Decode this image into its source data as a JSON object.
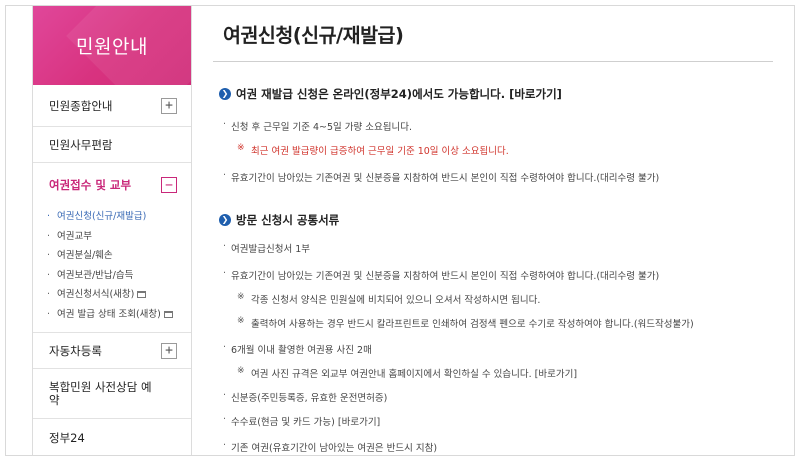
{
  "sidebar": {
    "header": "민원안내",
    "items": [
      {
        "label": "민원종합안내",
        "toggle": "+"
      },
      {
        "label": "민원사무편람",
        "toggle": ""
      },
      {
        "label": "여권접수 및 교부",
        "toggle": "−"
      },
      {
        "label": "자동차등록",
        "toggle": "+"
      },
      {
        "label": "복합민원 사전상담 예약",
        "toggle": ""
      },
      {
        "label": "정부24",
        "toggle": ""
      }
    ],
    "submenu": [
      {
        "label": "여권신청(신규/재발급)",
        "popup": false
      },
      {
        "label": "여권교부",
        "popup": false
      },
      {
        "label": "여권분실/훼손",
        "popup": false
      },
      {
        "label": "여권보관/반납/습득",
        "popup": false
      },
      {
        "label": "여권신청서식(새창)",
        "popup": true
      },
      {
        "label": "여권 발급 상태 조회(새창)",
        "popup": true
      }
    ]
  },
  "main": {
    "title": "여권신청(신규/재발급)",
    "section1": {
      "heading": "여권 재발급 신청은 온라인(정부24)에서도 가능합니다. [바로가기]",
      "items": [
        "신청 후 근무일 기준 4~5일 가량 소요됩니다.",
        "최근 여권 발급량이 급증하여 근무일 기준 10일 이상 소요됩니다.",
        "유효기간이 남아있는 기존여권 및 신분증을 지참하여 반드시 본인이 직접 수령하여야 합니다.(대리수령 불가)"
      ]
    },
    "section2": {
      "heading": "방문 신청시 공통서류",
      "items": [
        "여권발급신청서 1부",
        "유효기간이 남아있는 기존여권 및 신분증을 지참하여 반드시 본인이 직접 수령하여야 합니다.(대리수령 불가)",
        "각종 신청서 양식은 민원실에 비치되어 있으니 오셔서 작성하시면 됩니다.",
        "출력하여 사용하는 경우 반드시 칼라프린트로 인쇄하여 검정색 펜으로 수기로 작성하여야 합니다.(워드작성불가)",
        "6개월 이내 촬영한 여권용 사진 2매",
        "여권 사진 규격은 외교부 여권안내 홈페이지에서 확인하실 수 있습니다. [바로가기]",
        "신분증(주민등록증, 유효한 운전면허증)",
        "수수료(현금 및 카드 가능) [바로가기]",
        "기존 여권(유효기간이 남아있는 여권은 반드시 지참)"
      ]
    }
  },
  "colors": {
    "accent": "#d8327f",
    "link": "#3a6ab5",
    "warning": "#d0342c",
    "section_icon": "#1f5fae"
  },
  "icons": {
    "section": "circle-arrow-icon",
    "popup": "new-window-icon",
    "expand": "plus-icon",
    "collapse": "minus-icon"
  }
}
